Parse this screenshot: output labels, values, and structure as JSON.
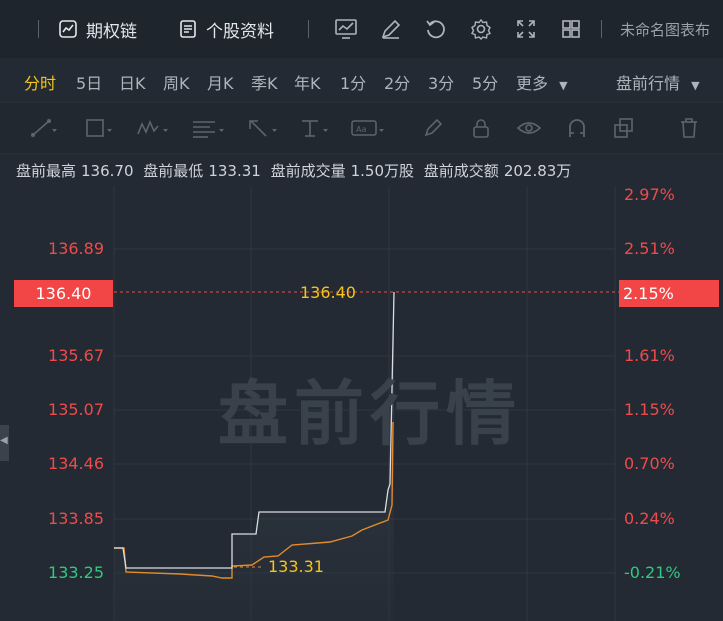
{
  "toolbar": {
    "option_chain": "期权链",
    "stock_profile": "个股资料",
    "chart_name": "未命名图表布",
    "icons": [
      "indicator-icon",
      "draw-icon",
      "refresh-icon",
      "settings-icon",
      "fullscreen-icon",
      "layout-icon"
    ]
  },
  "periods": {
    "items": [
      "分时",
      "5日",
      "日K",
      "周K",
      "月K",
      "季K",
      "年K",
      "1分",
      "2分",
      "3分",
      "5分",
      "更多"
    ],
    "active": "分时",
    "session": "盘前行情"
  },
  "info": {
    "high_label": "盘前最高",
    "high": "136.70",
    "low_label": "盘前最低",
    "low": "133.31",
    "volume_label": "盘前成交量",
    "volume": "1.50万股",
    "amount_label": "盘前成交额",
    "amount": "202.83万"
  },
  "axis": {
    "left_ticks": [
      "136.89",
      "135.67",
      "135.07",
      "134.46",
      "133.85",
      "133.25"
    ],
    "right_ticks": [
      "2.97%",
      "2.51%",
      "1.61%",
      "1.15%",
      "0.70%",
      "0.24%",
      "-0.21%"
    ],
    "current_price": "136.40",
    "current_pct": "2.15%"
  },
  "chart": {
    "watermark": "盘前行情",
    "price_label": "136.40",
    "low_label": "133.31",
    "colors": {
      "price_line": "#d9dde2",
      "avg_line": "#e38b2c",
      "up": "#ee4b4b",
      "down": "#2fc97f"
    }
  }
}
